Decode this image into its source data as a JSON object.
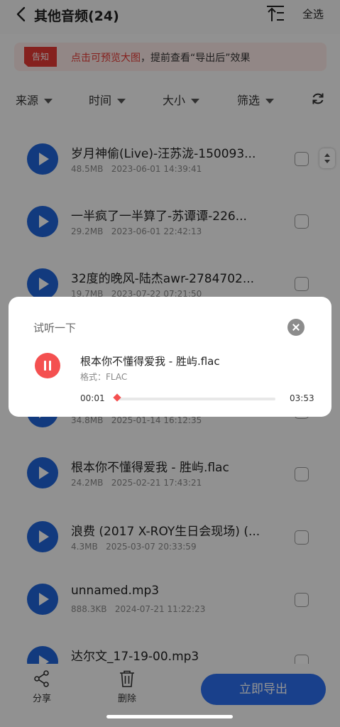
{
  "header": {
    "title": "其他音频(24)",
    "select_all": "全选"
  },
  "notice": {
    "tag": "告知",
    "highlight": "点击可预览大图",
    "rest": "，提前查看“导出后”效果"
  },
  "filters": [
    {
      "label": "来源"
    },
    {
      "label": "时间"
    },
    {
      "label": "大小"
    },
    {
      "label": "筛选"
    }
  ],
  "files": [
    {
      "name": "岁月神偷(Live)-汪苏泷-150093...",
      "size": "48.5MB",
      "date": "2023-06-01 14:39:41"
    },
    {
      "name": "一半疯了一半算了-苏谭谭-226...",
      "size": "29.2MB",
      "date": "2023-06-01 22:42:13"
    },
    {
      "name": "32度的晚风-陆杰awr-2784702...",
      "size": "19.7MB",
      "date": "2023-07-22 07:21:50"
    },
    {
      "name": "",
      "size": "34.8MB",
      "date": "2025-01-14 16:12:35"
    },
    {
      "name": "根本你不懂得爱我 - 胜屿.flac",
      "size": "24.2MB",
      "date": "2025-02-21 17:43:21"
    },
    {
      "name": "浪费 (2017 X-ROY生日会现场) (...",
      "size": "4.3MB",
      "date": "2025-03-07 20:33:59"
    },
    {
      "name": "unnamed.mp3",
      "size": "888.3KB",
      "date": "2024-07-21 11:22:23"
    },
    {
      "name": "达尔文_17-19-00.mp3",
      "size": "",
      "date": ""
    }
  ],
  "bottom": {
    "share": "分享",
    "delete": "删除",
    "export": "立即导出"
  },
  "dialog": {
    "title": "试听一下",
    "song": "根本你不懂得爱我 - 胜屿.flac",
    "format": "格式：FLAC",
    "current_time": "00:01",
    "total_time": "03:53",
    "progress": 0.004
  },
  "colors": {
    "accent": "#1f64d9",
    "player": "#f45050",
    "notice_red": "#e53935"
  }
}
